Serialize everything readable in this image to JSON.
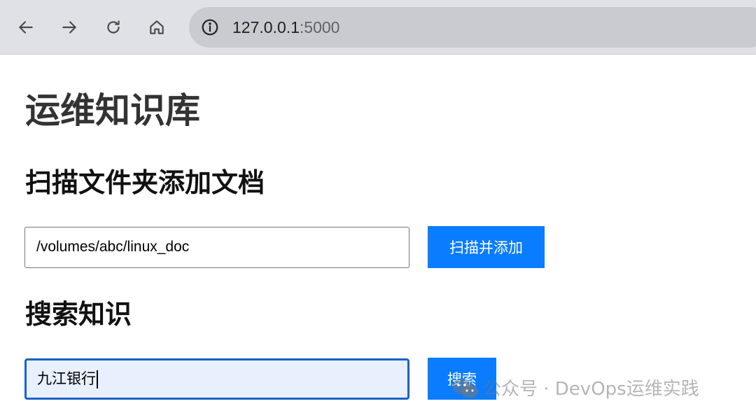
{
  "browser": {
    "url_host": "127.0.0.1",
    "url_port": ":5000",
    "icons": {
      "back": "arrow-left-icon",
      "forward": "arrow-right-icon",
      "reload": "reload-icon",
      "home": "home-icon",
      "site_info": "info-icon"
    }
  },
  "page": {
    "title": "运维知识库",
    "scan_section": {
      "heading": "扫描文件夹添加文档",
      "input_value": "/volumes/abc/linux_doc",
      "button_label": "扫描并添加"
    },
    "search_section": {
      "heading": "搜索知识",
      "input_value": "九江银行",
      "button_label": "搜索"
    }
  },
  "watermark": {
    "text": "公众号 · DevOps运维实践",
    "icon": "wechat-icon"
  },
  "colors": {
    "accent": "#0a7cff",
    "focus_border": "#1a62c7",
    "focus_fill": "#e8f0fe",
    "toolbar_bg": "#dfe1e6"
  }
}
